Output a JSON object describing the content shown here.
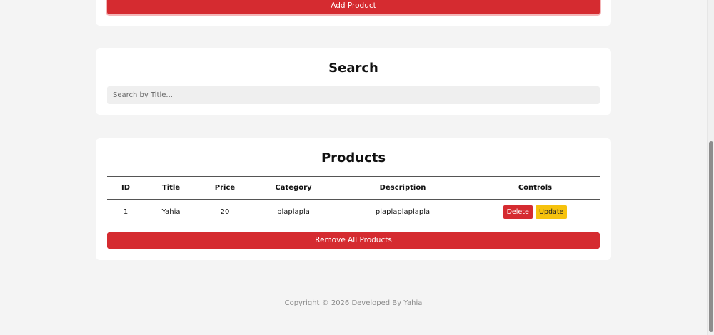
{
  "add_section": {
    "add_button_label": "Add Product"
  },
  "search": {
    "title": "Search",
    "placeholder": "Search by Title..."
  },
  "products": {
    "title": "Products",
    "columns": [
      "ID",
      "Title",
      "Price",
      "Category",
      "Description",
      "Controls"
    ],
    "rows": [
      {
        "id": "1",
        "title": "Yahia",
        "price": "20",
        "category": "plaplapla",
        "description": "plaplaplaplapla",
        "delete_label": "Delete",
        "update_label": "Update"
      }
    ],
    "remove_all_label": "Remove All Products"
  },
  "footer": {
    "copyright": "Copyright © 2026 Developed By Yahia"
  },
  "colors": {
    "primary_red": "#d52b30",
    "update_yellow": "#f6c20d",
    "page_background": "#f4f4f4",
    "card_background": "#ffffff"
  }
}
